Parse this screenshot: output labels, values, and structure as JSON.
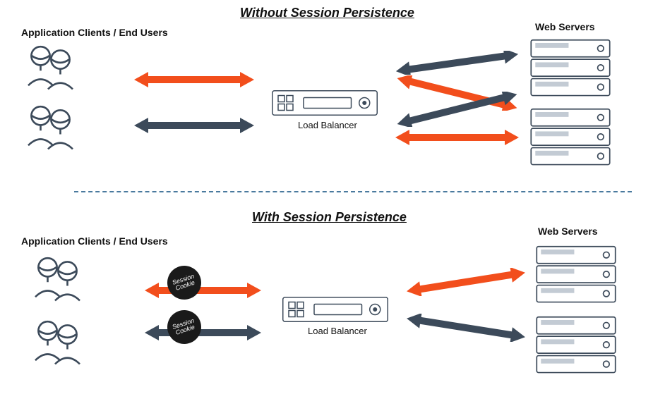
{
  "without": {
    "title": "Without Session Persistence",
    "clients_label": "Application Clients / End Users",
    "lb_label": "Load Balancer",
    "servers_label": "Web Servers"
  },
  "with": {
    "title": "With Session Persistence",
    "clients_label": "Application Clients / End Users",
    "lb_label": "Load Balancer",
    "servers_label": "Web Servers",
    "cookie_label_1": "Session Cookie",
    "cookie_label_2": "Session Cookie"
  },
  "colors": {
    "orange": "#f24e1c",
    "slate": "#3c4a5a",
    "outline": "#9aa5b3"
  }
}
